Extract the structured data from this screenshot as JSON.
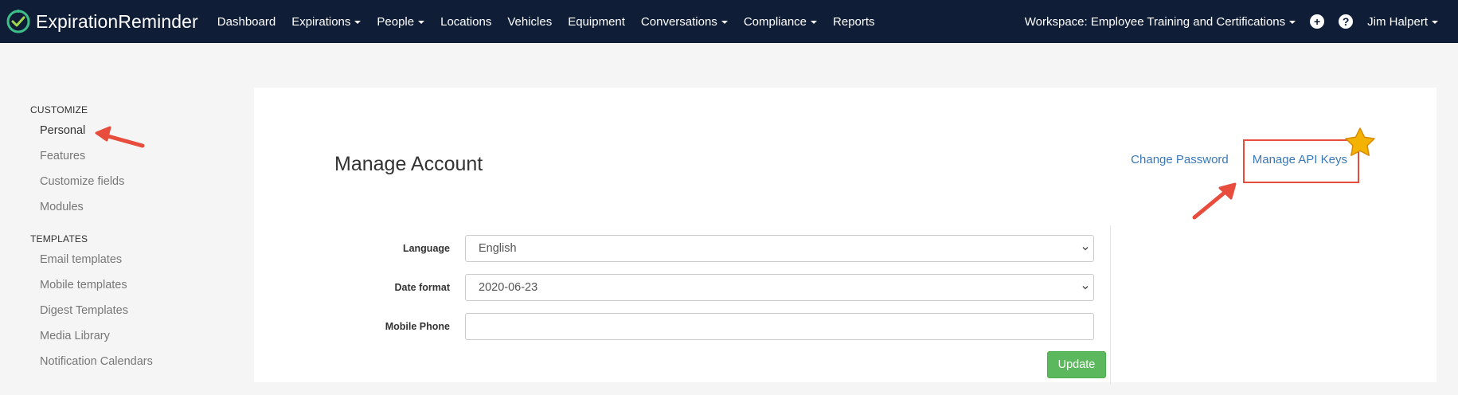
{
  "brand": {
    "part1": "Expiration",
    "part2": "Reminder"
  },
  "nav": {
    "items": [
      {
        "label": "Dashboard",
        "dropdown": false
      },
      {
        "label": "Expirations",
        "dropdown": true
      },
      {
        "label": "People",
        "dropdown": true
      },
      {
        "label": "Locations",
        "dropdown": false
      },
      {
        "label": "Vehicles",
        "dropdown": false
      },
      {
        "label": "Equipment",
        "dropdown": false
      },
      {
        "label": "Conversations",
        "dropdown": true
      },
      {
        "label": "Compliance",
        "dropdown": true
      },
      {
        "label": "Reports",
        "dropdown": false
      }
    ],
    "workspace": "Workspace: Employee Training and Certifications",
    "add_icon": "plus-circle-icon",
    "help_icon": "question-circle-icon",
    "user": "Jim Halpert"
  },
  "sidebar": {
    "customize_heading": "CUSTOMIZE",
    "customize_items": [
      "Personal",
      "Features",
      "Customize fields",
      "Modules"
    ],
    "templates_heading": "TEMPLATES",
    "templates_items": [
      "Email templates",
      "Mobile templates",
      "Digest Templates",
      "Media Library",
      "Notification Calendars"
    ]
  },
  "main": {
    "title": "Manage Account",
    "change_password": "Change Password",
    "manage_api_keys": "Manage API Keys",
    "form": {
      "language_label": "Language",
      "language_value": "English",
      "date_format_label": "Date format",
      "date_format_value": "2020-06-23",
      "mobile_phone_label": "Mobile Phone",
      "mobile_phone_value": "",
      "update_label": "Update"
    }
  },
  "colors": {
    "nav_bg": "#0f1d36",
    "link": "#3a78b8",
    "update_button": "#5cb85c",
    "annotation_red": "#e74c3c",
    "star": "#f5b301"
  }
}
